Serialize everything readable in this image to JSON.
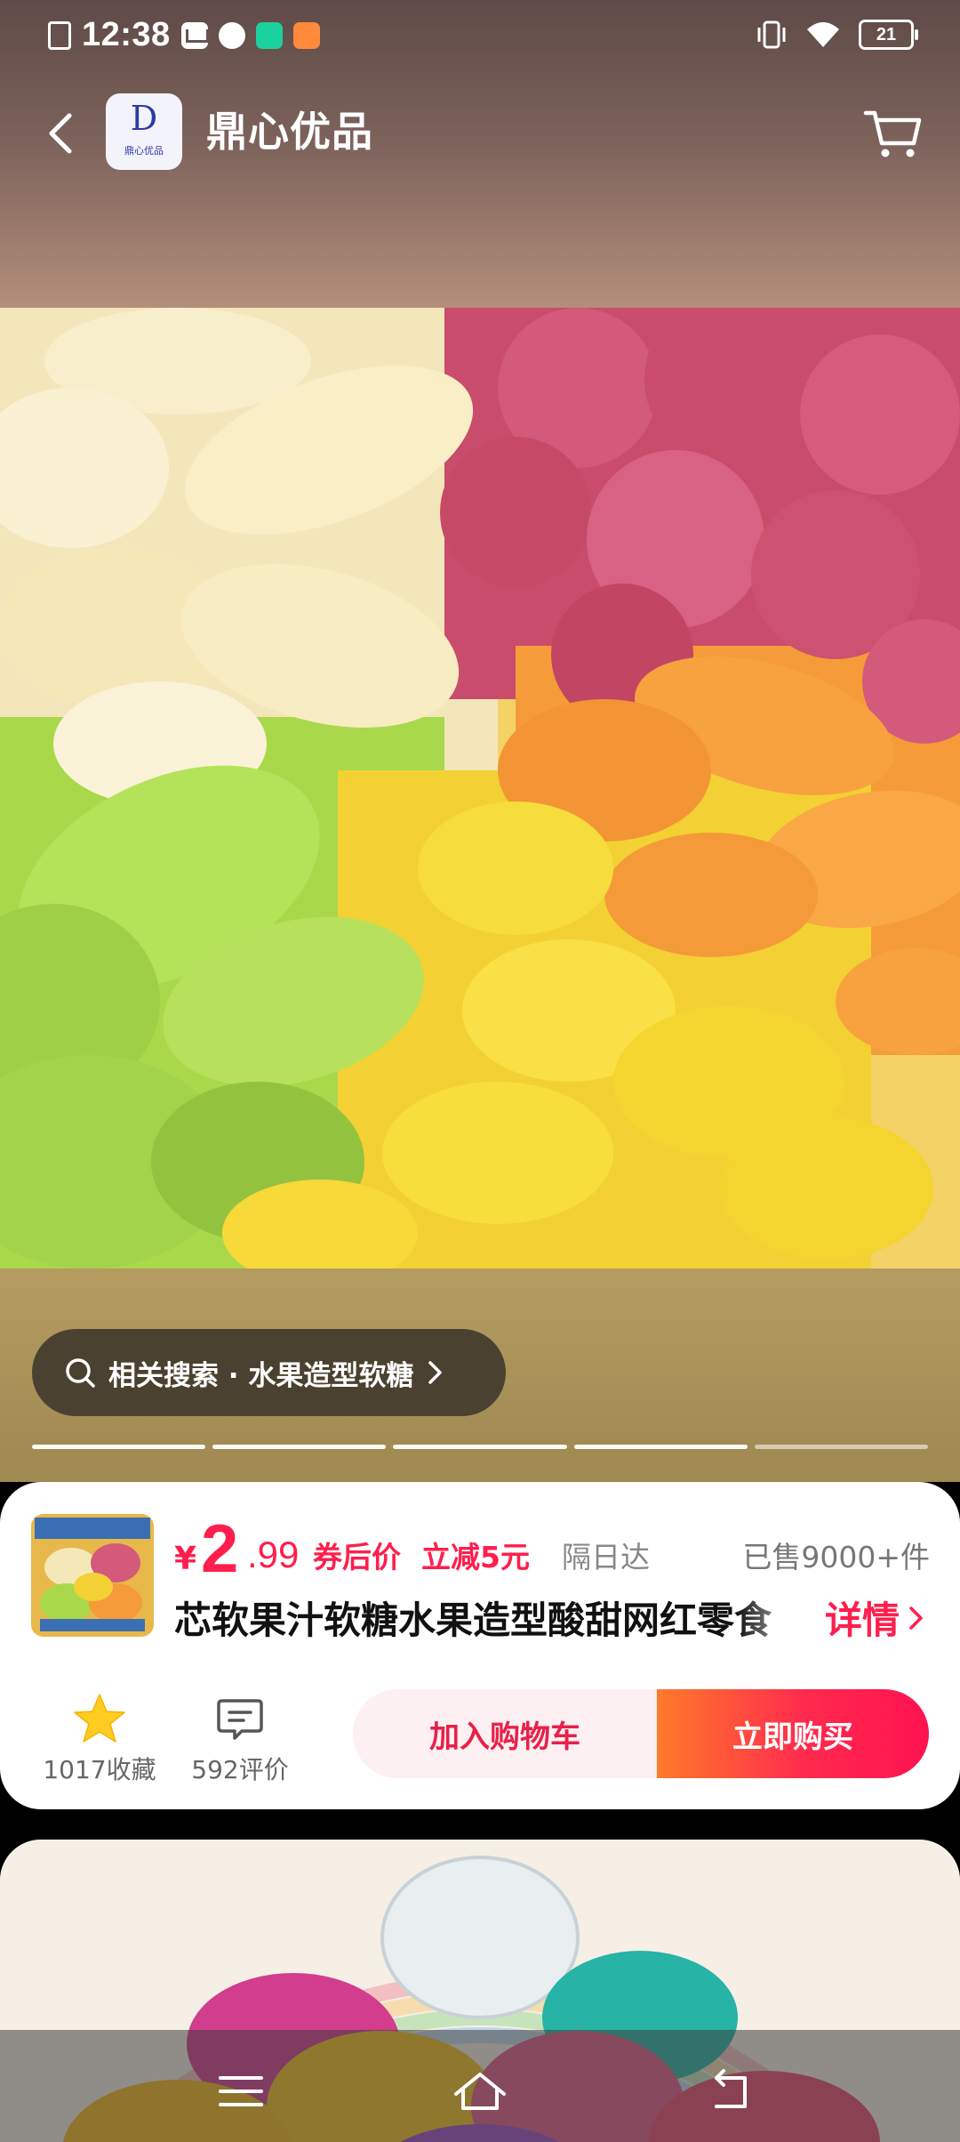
{
  "status_bar": {
    "time": "12:38",
    "left_icons": [
      "sim-card-icon",
      "mail-app-icon",
      "app-icon",
      "camera-app-icon",
      "video-app-icon"
    ],
    "right_icons": [
      "vibrate-icon",
      "wifi-icon",
      "battery-icon"
    ],
    "battery_level": "21"
  },
  "header": {
    "logo_letter": "D",
    "logo_text": "鼎心优品",
    "shop_name": "鼎心优品"
  },
  "gallery": {
    "related_search": "相关搜索 · 水果造型软糖",
    "image_count": 5,
    "current_index": 4
  },
  "product": {
    "currency": "¥",
    "price_int": "2",
    "price_dec": ".99",
    "coupon_label": "券后价",
    "discount_label": "立减5元",
    "delivery_label": "隔日达",
    "sold_label": "已售9000+件",
    "title": "芯软果汁软糖水果造型酸甜网红零食",
    "detail_label": "详情"
  },
  "actions": {
    "favorite_label": "1017收藏",
    "review_label": "592评价",
    "add_cart_label": "加入购物车",
    "buy_now_label": "立即购买"
  },
  "colors": {
    "accent": "#ff1e4d",
    "favorite_star": "#ffcc22"
  }
}
